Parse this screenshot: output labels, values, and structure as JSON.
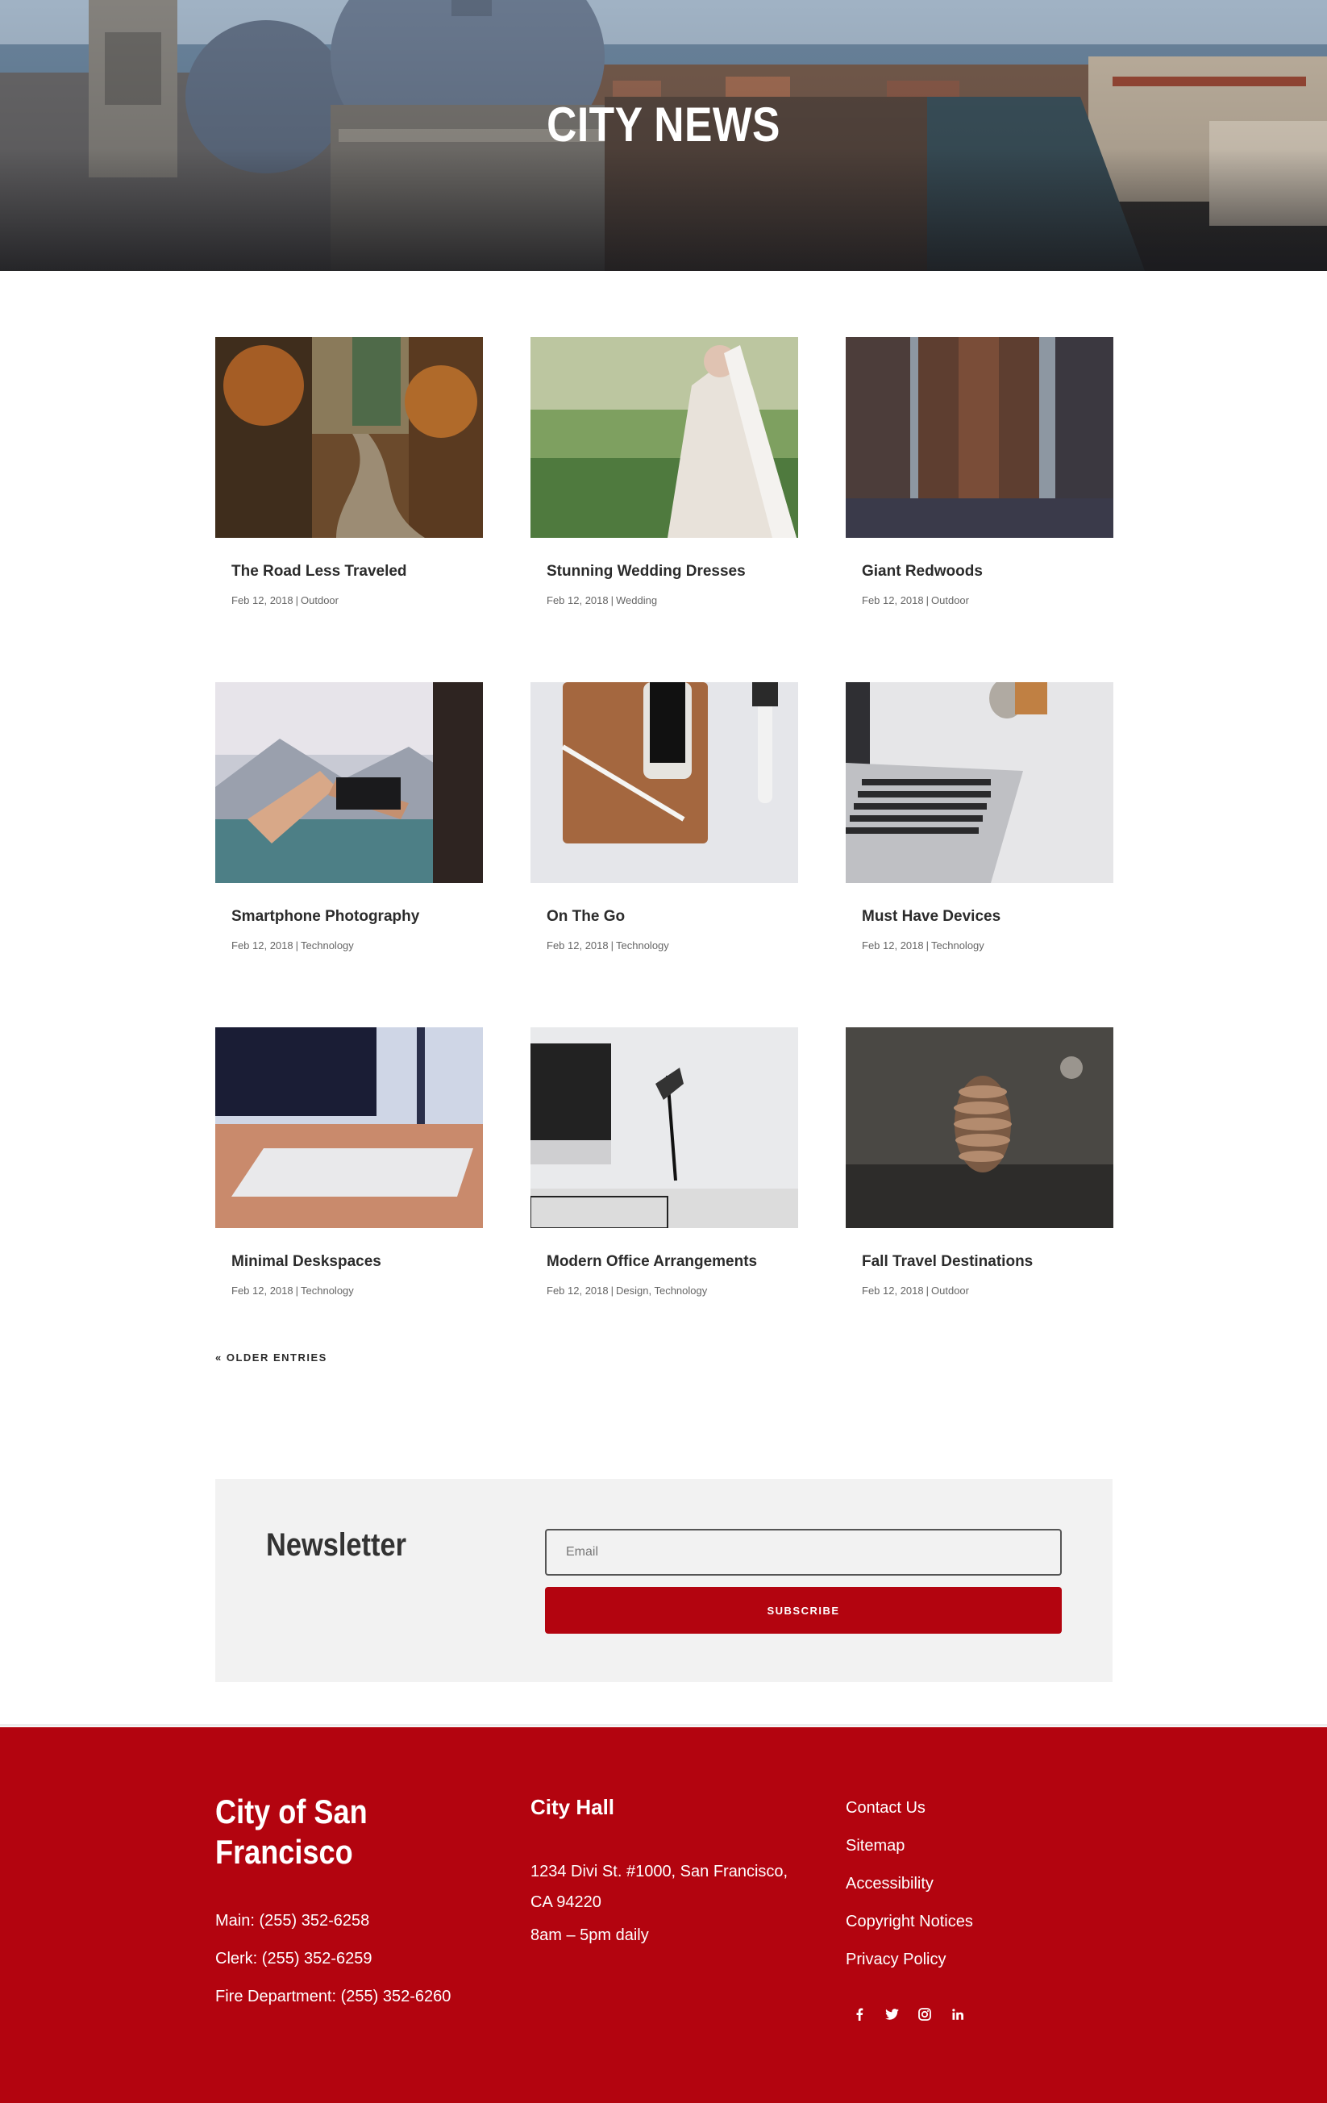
{
  "hero": {
    "title": "CITY NEWS"
  },
  "posts": [
    {
      "title": "The Road Less Traveled",
      "date": "Feb 12, 2018",
      "categories": "Outdoor"
    },
    {
      "title": "Stunning Wedding Dresses",
      "date": "Feb 12, 2018",
      "categories": "Wedding"
    },
    {
      "title": "Giant Redwoods",
      "date": "Feb 12, 2018",
      "categories": "Outdoor"
    },
    {
      "title": "Smartphone Photography",
      "date": "Feb 12, 2018",
      "categories": "Technology"
    },
    {
      "title": "On The Go",
      "date": "Feb 12, 2018",
      "categories": "Technology"
    },
    {
      "title": "Must Have Devices",
      "date": "Feb 12, 2018",
      "categories": "Technology"
    },
    {
      "title": "Minimal Deskspaces",
      "date": "Feb 12, 2018",
      "categories": "Technology"
    },
    {
      "title": "Modern Office Arrangements",
      "date": "Feb 12, 2018",
      "categories": "Design, Technology"
    },
    {
      "title": "Fall Travel Destinations",
      "date": "Feb 12, 2018",
      "categories": "Outdoor"
    }
  ],
  "pagination": {
    "older_label": "« OLDER ENTRIES"
  },
  "newsletter": {
    "title": "Newsletter",
    "email_placeholder": "Email",
    "subscribe_label": "SUBSCRIBE"
  },
  "footer": {
    "city_name": "City of San Francisco",
    "phones": [
      "Main: (255) 352-6258",
      "Clerk: (255) 352-6259",
      "Fire Department: (255) 352-6260"
    ],
    "city_hall": {
      "title": "City Hall",
      "address": "1234 Divi St. #1000, San Francisco, CA 94220",
      "hours": "8am – 5pm daily"
    },
    "links": [
      "Contact Us",
      "Sitemap",
      "Accessibility",
      "Copyright Notices",
      "Privacy Policy"
    ],
    "socials": [
      "facebook-icon",
      "twitter-icon",
      "instagram-icon",
      "linkedin-icon"
    ]
  },
  "colors": {
    "brand_red": "#b3040f",
    "newsletter_bg": "#f2f2f2",
    "text_dark": "#2b2b2b"
  }
}
